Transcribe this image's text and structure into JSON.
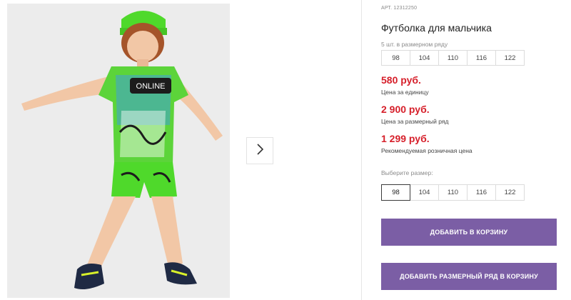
{
  "product": {
    "article": "АРТ. 12312250",
    "title": "Футболка для мальчика"
  },
  "pack_sizes": {
    "label": "5 шт. в размерном ряду",
    "sizes": [
      "98",
      "104",
      "110",
      "116",
      "122"
    ]
  },
  "prices": [
    {
      "value": "580 руб.",
      "note": "Цена за единицу"
    },
    {
      "value": "2 900 руб.",
      "note": "Цена за размерный ряд"
    },
    {
      "value": "1 299 руб.",
      "note": "Рекомендуемая розничная цена"
    }
  ],
  "size_picker": {
    "label": "Выберите размер:",
    "sizes": [
      "98",
      "104",
      "110",
      "116",
      "122"
    ],
    "selected": "98"
  },
  "buttons": {
    "add_to_cart": "ДОБАВИТЬ В КОРЗИНУ",
    "add_set_to_cart": "ДОБАВИТЬ РАЗМЕРНЫЙ РЯД В КОРЗИНУ"
  },
  "gallery": {
    "next_icon": "chevron-right-icon",
    "shirt_print": "ONLINE"
  },
  "colors": {
    "price": "#d61f2a",
    "button": "#7b5ea5",
    "accent_green": "#4fd92b"
  }
}
